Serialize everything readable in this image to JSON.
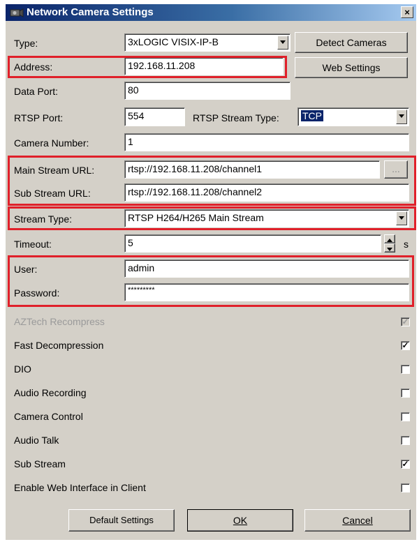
{
  "window": {
    "title": "Network Camera Settings",
    "close_glyph": "×"
  },
  "fields": {
    "type_label": "Type:",
    "type_value": "3xLOGIC VISIX-IP-B",
    "address_label": "Address:",
    "address_value": "192.168.11.208",
    "data_port_label": "Data Port:",
    "data_port_value": "80",
    "rtsp_port_label": "RTSP Port:",
    "rtsp_port_value": "554",
    "rtsp_stream_type_label": "RTSP Stream Type:",
    "rtsp_stream_type_value": "TCP",
    "camera_number_label": "Camera Number:",
    "camera_number_value": "1",
    "main_stream_url_label": "Main Stream URL:",
    "main_stream_url_value": "rtsp://192.168.11.208/channel1",
    "sub_stream_url_label": "Sub Stream URL:",
    "sub_stream_url_value": "rtsp://192.168.11.208/channel2",
    "stream_type_label": "Stream Type:",
    "stream_type_value": "RTSP H264/H265 Main Stream",
    "timeout_label": "Timeout:",
    "timeout_value": "5",
    "timeout_unit": "s",
    "user_label": "User:",
    "user_value": "admin",
    "password_label": "Password:",
    "password_value": "*********",
    "browse_label": "..."
  },
  "buttons": {
    "detect_cameras": "Detect Cameras",
    "web_settings": "Web Settings",
    "default_settings": "Default Settings",
    "ok": "OK",
    "cancel": "Cancel"
  },
  "options": [
    {
      "label": "AZTech Recompress",
      "checked": true,
      "disabled": true
    },
    {
      "label": "Fast Decompression",
      "checked": true,
      "disabled": false
    },
    {
      "label": "DIO",
      "checked": false,
      "disabled": false
    },
    {
      "label": "Audio Recording",
      "checked": false,
      "disabled": false
    },
    {
      "label": "Camera Control",
      "checked": false,
      "disabled": false
    },
    {
      "label": "Audio Talk",
      "checked": false,
      "disabled": false
    },
    {
      "label": "Sub Stream",
      "checked": true,
      "disabled": false
    },
    {
      "label": "Enable Web Interface in Client",
      "checked": false,
      "disabled": false
    }
  ],
  "colors": {
    "highlight_box": "#e0202a",
    "selection": "#0a246a",
    "dialog_bg": "#d4d0c8"
  }
}
